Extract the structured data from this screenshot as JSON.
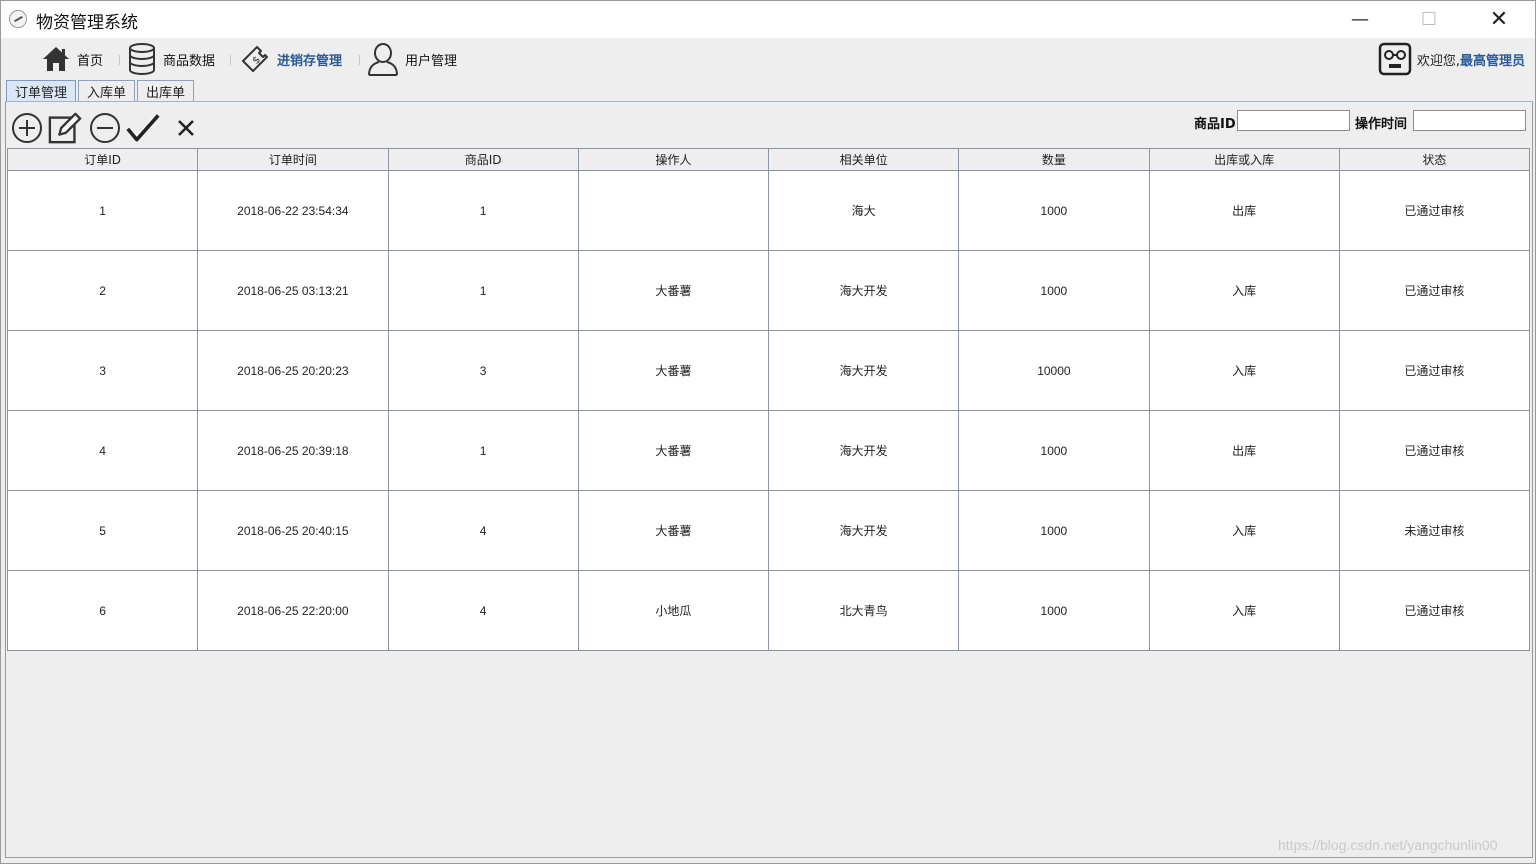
{
  "window": {
    "title": "物资管理系统",
    "minimize": "—",
    "maximize": "☐",
    "close": "✕"
  },
  "menu": {
    "items": [
      {
        "label": "首页"
      },
      {
        "label": "商品数据"
      },
      {
        "label": "进销存管理"
      },
      {
        "label": "用户管理"
      }
    ],
    "welcome": "欢迎您,",
    "user": "最高管理员"
  },
  "tabs": [
    {
      "label": "订单管理"
    },
    {
      "label": "入库单"
    },
    {
      "label": "出库单"
    }
  ],
  "search": {
    "product_id_label": "商品ID",
    "product_id_value": "",
    "time_label": "操作时间",
    "time_value": ""
  },
  "table": {
    "headers": [
      "订单ID",
      "订单时间",
      "商品ID",
      "操作人",
      "相关单位",
      "数量",
      "出库或入库",
      "状态"
    ],
    "rows": [
      [
        "1",
        "2018-06-22 23:54:34",
        "1",
        "",
        "海大",
        "1000",
        "出库",
        "已通过审核"
      ],
      [
        "2",
        "2018-06-25 03:13:21",
        "1",
        "大番薯",
        "海大开发",
        "1000",
        "入库",
        "已通过审核"
      ],
      [
        "3",
        "2018-06-25 20:20:23",
        "3",
        "大番薯",
        "海大开发",
        "10000",
        "入库",
        "已通过审核"
      ],
      [
        "4",
        "2018-06-25 20:39:18",
        "1",
        "大番薯",
        "海大开发",
        "1000",
        "出库",
        "已通过审核"
      ],
      [
        "5",
        "2018-06-25 20:40:15",
        "4",
        "大番薯",
        "海大开发",
        "1000",
        "入库",
        "未通过审核"
      ],
      [
        "6",
        "2018-06-25 22:20:00",
        "4",
        "小地瓜",
        "北大青鸟",
        "1000",
        "入库",
        "已通过审核"
      ]
    ]
  },
  "watermark": "https://blog.csdn.net/yangchunlin00",
  "colors": {
    "accent": "#2a5c9a",
    "grid": "#8a96a8",
    "background": "#eeeeee"
  }
}
